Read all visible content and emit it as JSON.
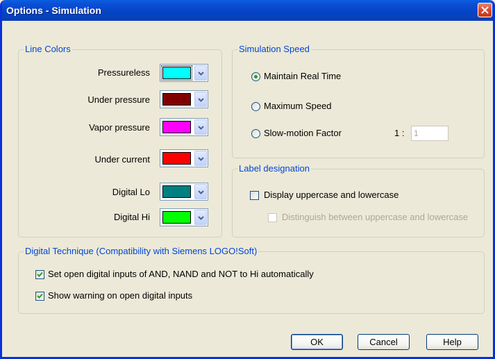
{
  "window": {
    "title": "Options - Simulation"
  },
  "line_colors": {
    "group_title": "Line Colors",
    "rows": [
      {
        "label": "Pressureless",
        "color": "#00ffff"
      },
      {
        "label": "Under pressure",
        "color": "#800000"
      },
      {
        "label": "Vapor pressure",
        "color": "#ff00ff"
      },
      {
        "label": "Under current",
        "color": "#ff0000"
      },
      {
        "label": "Digital Lo",
        "color": "#008080"
      },
      {
        "label": "Digital Hi",
        "color": "#00ff00"
      }
    ]
  },
  "simulation_speed": {
    "group_title": "Simulation Speed",
    "options": [
      {
        "label": "Maintain Real Time",
        "selected": true
      },
      {
        "label": "Maximum Speed",
        "selected": false
      },
      {
        "label": "Slow-motion Factor",
        "selected": false
      }
    ],
    "factor_prefix": "1 :",
    "factor_value": "1"
  },
  "label_designation": {
    "group_title": "Label designation",
    "display_case_label": "Display uppercase and lowercase",
    "display_case_checked": false,
    "distinguish_case_label": "Distinguish between uppercase and lowercase",
    "distinguish_case_checked": false
  },
  "digital_technique": {
    "group_title": "Digital Technique (Compatibility with Siemens LOGO!Soft)",
    "set_open_inputs_label": "Set open digital inputs of AND, NAND and NOT to Hi automatically",
    "set_open_inputs_checked": true,
    "show_warning_label": "Show warning on open digital inputs",
    "show_warning_checked": true
  },
  "buttons": {
    "ok": "OK",
    "cancel": "Cancel",
    "help": "Help"
  }
}
